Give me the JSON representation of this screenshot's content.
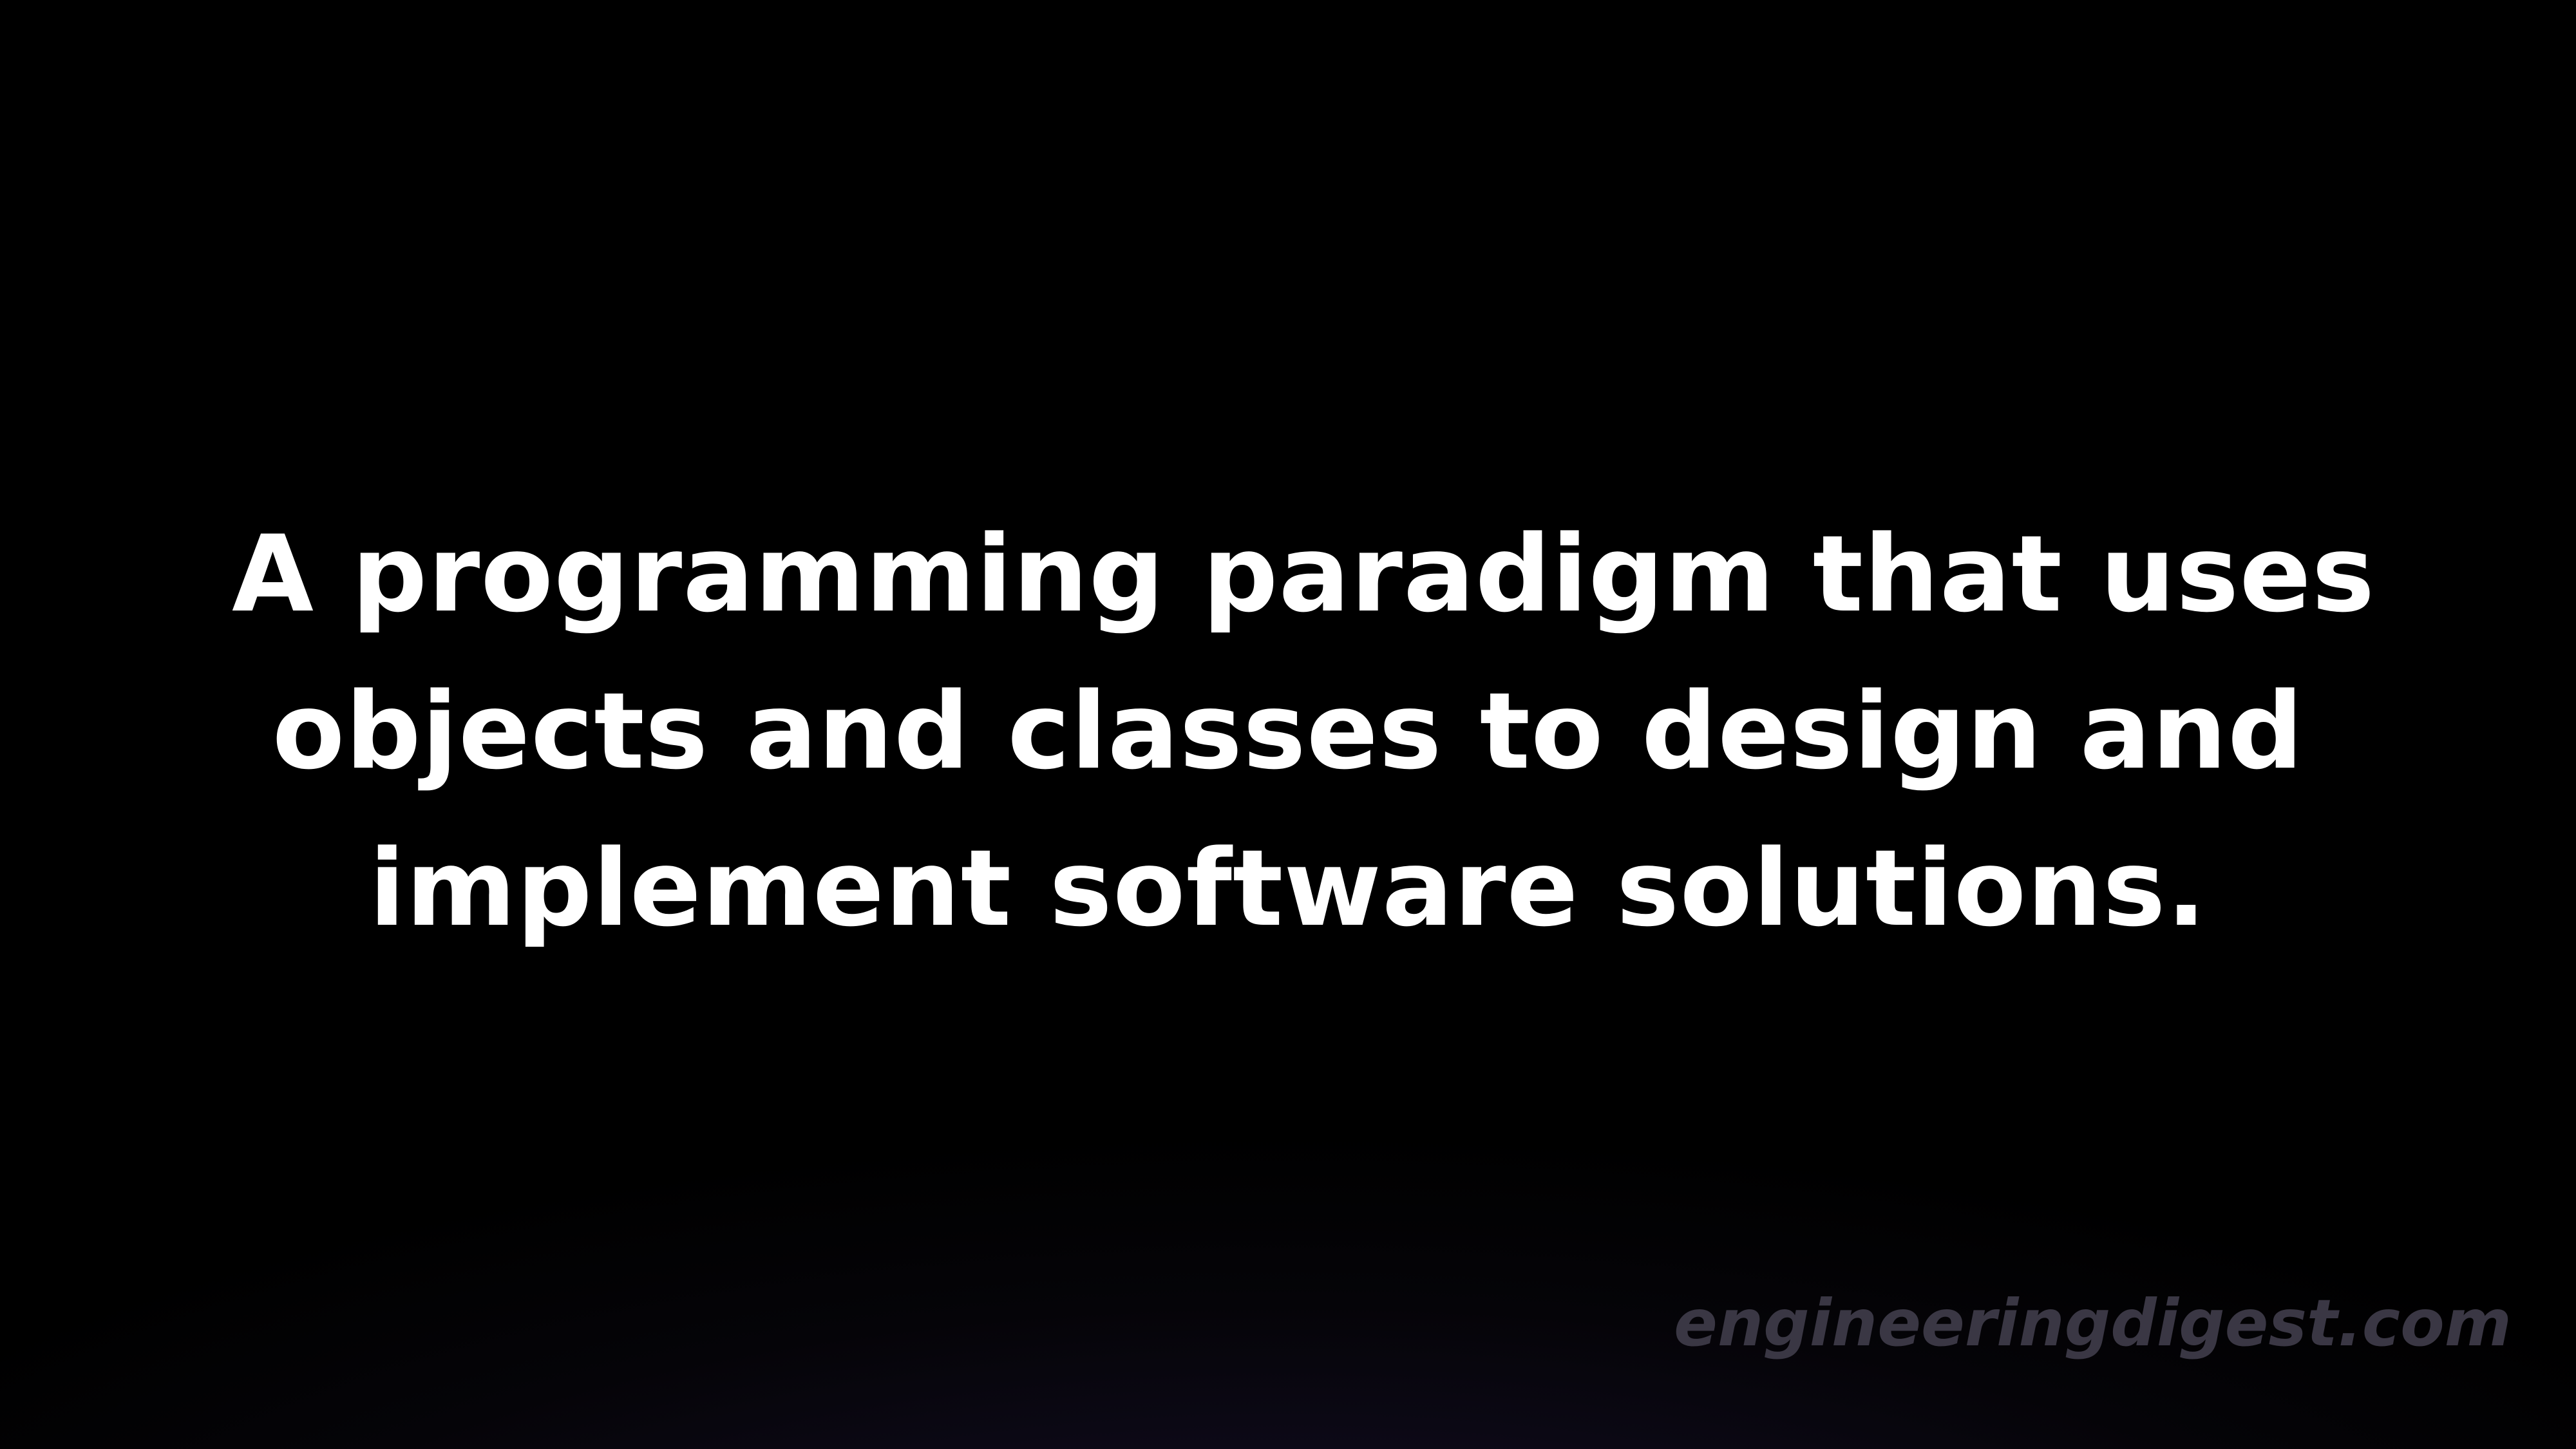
{
  "headline": {
    "lines": [
      "A programming paradigm that uses",
      "objects and classes to design and",
      "implement software solutions."
    ]
  },
  "watermark": {
    "text": "engineeringdigest.com"
  },
  "colors": {
    "background": "#000000",
    "background_glow": "#1a1230",
    "headline_text": "#ffffff",
    "watermark_text": "#3a3744"
  }
}
